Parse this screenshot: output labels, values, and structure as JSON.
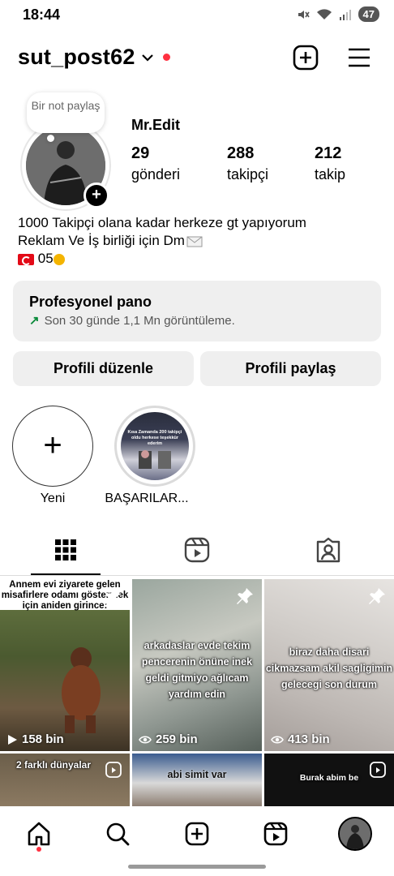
{
  "status_bar": {
    "time": "18:44",
    "battery": "47"
  },
  "header": {
    "username": "sut_post62",
    "chevron": "⌄"
  },
  "note": {
    "text": "Bir not paylaş"
  },
  "profile": {
    "display_name": "Mr.Edit",
    "stats": [
      {
        "value": "29",
        "label": "gönderi"
      },
      {
        "value": "288",
        "label": "takipçi"
      },
      {
        "value": "212",
        "label": "takip"
      }
    ],
    "bio_line1": "1000 Takipçi olana kadar herkeze gt yapıyorum",
    "bio_line2": "Reklam Ve İş birliği için Dm",
    "bio_line3": "05"
  },
  "dashboard": {
    "title": "Profesyonel pano",
    "subtitle": "Son 30 günde 1,1 Mn görüntüleme."
  },
  "buttons": {
    "edit": "Profili düzenle",
    "share": "Profili paylaş"
  },
  "highlights": [
    {
      "label": "Yeni"
    },
    {
      "label": "BAŞARILAR..."
    }
  ],
  "highlight_image_text": "Kısa Zamanda 200 takipçi oldu herkese teşekkür ederim",
  "posts": [
    {
      "caption": "Annem evi ziyarete gelen misafirlere odamı göstermek için aniden girince:",
      "views": "158 bin",
      "pinned": true
    },
    {
      "caption": "arkadaslar evde tekim pencerenin önüne inek geldi gitmiyo ağlıcam yardım edin",
      "views": "259 bin",
      "pinned": true
    },
    {
      "caption": "biraz daha disari cikmazsam akil sagligimin gelecegi son durum",
      "views": "413 bin",
      "pinned": true
    },
    {
      "caption": "2 farklı dünyalar",
      "views": "",
      "pinned": false
    },
    {
      "caption": "abi simit var",
      "views": "",
      "pinned": false
    },
    {
      "caption": "Burak abim be",
      "views": "",
      "pinned": false
    }
  ],
  "colors": {
    "accent_red": "#ff3040",
    "surface": "#efefef",
    "growth_green": "#0a8a3a"
  }
}
